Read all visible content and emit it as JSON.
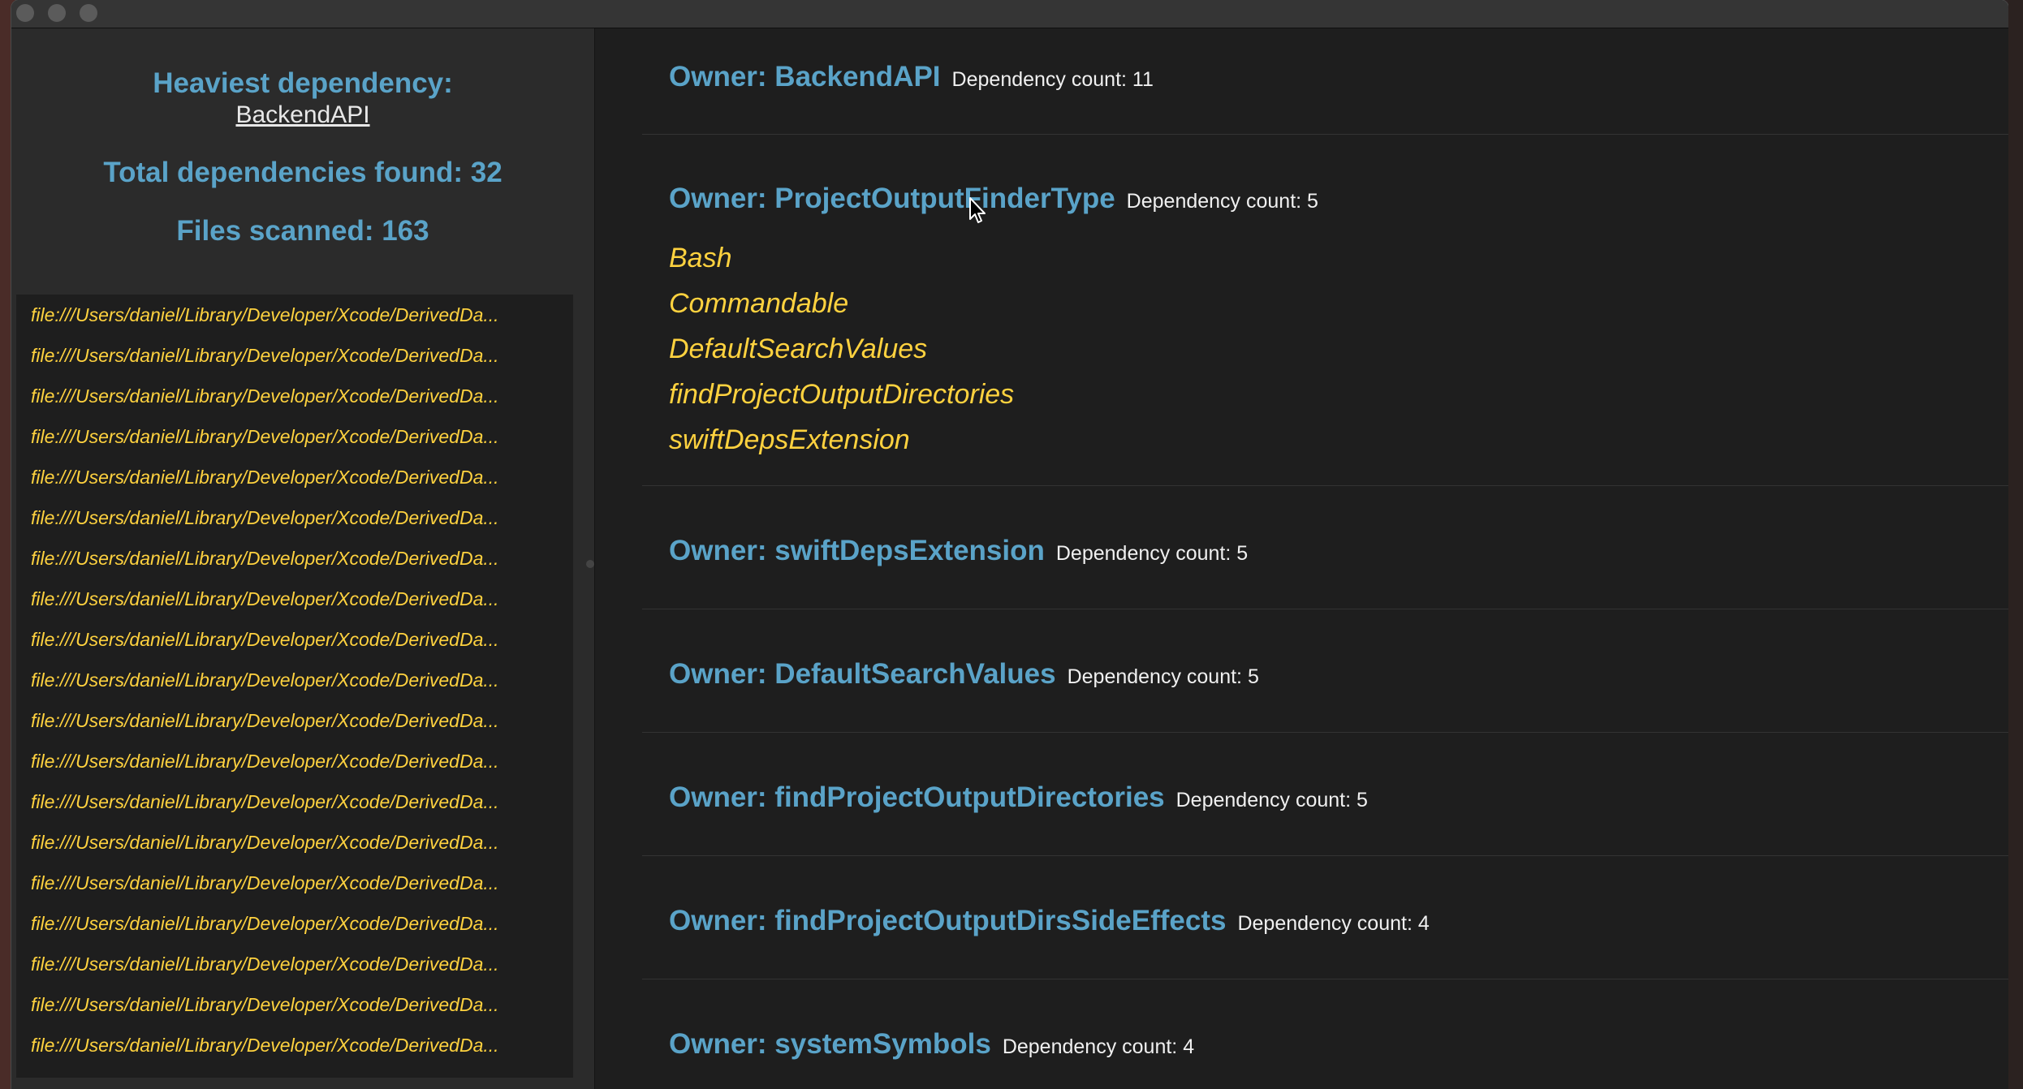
{
  "window": {
    "controls": [
      "close",
      "minimize",
      "zoom"
    ]
  },
  "summary": {
    "heaviest_label": "Heaviest dependency:",
    "heaviest_name": "BackendAPI",
    "total_dependencies": "Total dependencies found: 32",
    "files_scanned": "Files scanned: 163"
  },
  "files": [
    "file:///Users/daniel/Library/Developer/Xcode/DerivedDa...",
    "file:///Users/daniel/Library/Developer/Xcode/DerivedDa...",
    "file:///Users/daniel/Library/Developer/Xcode/DerivedDa...",
    "file:///Users/daniel/Library/Developer/Xcode/DerivedDa...",
    "file:///Users/daniel/Library/Developer/Xcode/DerivedDa...",
    "file:///Users/daniel/Library/Developer/Xcode/DerivedDa...",
    "file:///Users/daniel/Library/Developer/Xcode/DerivedDa...",
    "file:///Users/daniel/Library/Developer/Xcode/DerivedDa...",
    "file:///Users/daniel/Library/Developer/Xcode/DerivedDa...",
    "file:///Users/daniel/Library/Developer/Xcode/DerivedDa...",
    "file:///Users/daniel/Library/Developer/Xcode/DerivedDa...",
    "file:///Users/daniel/Library/Developer/Xcode/DerivedDa...",
    "file:///Users/daniel/Library/Developer/Xcode/DerivedDa...",
    "file:///Users/daniel/Library/Developer/Xcode/DerivedDa...",
    "file:///Users/daniel/Library/Developer/Xcode/DerivedDa...",
    "file:///Users/daniel/Library/Developer/Xcode/DerivedDa...",
    "file:///Users/daniel/Library/Developer/Xcode/DerivedDa...",
    "file:///Users/daniel/Library/Developer/Xcode/DerivedDa...",
    "file:///Users/daniel/Library/Developer/Xcode/DerivedDa..."
  ],
  "owners": [
    {
      "name": "Owner: BackendAPI",
      "count": "Dependency count: 11",
      "dependencies": []
    },
    {
      "name": "Owner: ProjectOutputFinderType",
      "count": "Dependency count: 5",
      "dependencies": [
        "Bash",
        "Commandable",
        "DefaultSearchValues",
        "findProjectOutputDirectories",
        "swiftDepsExtension"
      ]
    },
    {
      "name": "Owner: swiftDepsExtension",
      "count": "Dependency count: 5",
      "dependencies": []
    },
    {
      "name": "Owner: DefaultSearchValues",
      "count": "Dependency count: 5",
      "dependencies": []
    },
    {
      "name": "Owner: findProjectOutputDirectories",
      "count": "Dependency count: 5",
      "dependencies": []
    },
    {
      "name": "Owner: findProjectOutputDirsSideEffects",
      "count": "Dependency count: 4",
      "dependencies": []
    },
    {
      "name": "Owner: systemSymbols",
      "count": "Dependency count: 4",
      "dependencies": []
    }
  ],
  "colors": {
    "accent_blue": "#5aa3c8",
    "symbol_yellow": "#ffd23f",
    "window_bg": "#1e1e1e",
    "sidebar_bg": "#2b2b2b"
  },
  "icons": {
    "cursor": "arrow-cursor-icon"
  }
}
